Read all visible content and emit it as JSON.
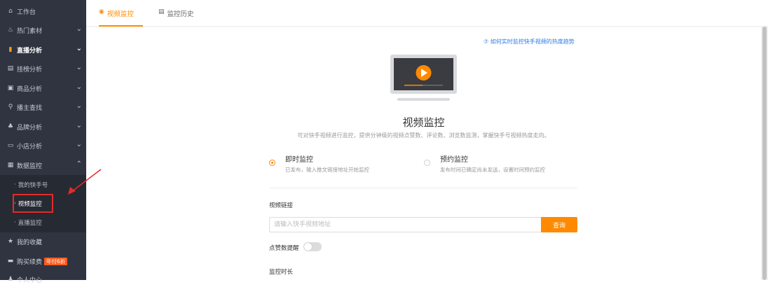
{
  "sidebar": {
    "items": [
      {
        "label": "工作台",
        "icon": "home-icon"
      },
      {
        "label": "热门素材",
        "icon": "flame-icon"
      },
      {
        "label": "直播分析",
        "icon": "bar-chart-icon"
      },
      {
        "label": "挂榜分析",
        "icon": "trend-icon"
      },
      {
        "label": "商品分析",
        "icon": "shop-icon"
      },
      {
        "label": "播主查找",
        "icon": "search-icon"
      },
      {
        "label": "品牌分析",
        "icon": "brand-icon"
      },
      {
        "label": "小店分析",
        "icon": "store-icon"
      },
      {
        "label": "数据监控",
        "icon": "monitor-icon"
      }
    ],
    "sub_items": [
      {
        "label": "我的快手号"
      },
      {
        "label": "视频监控"
      },
      {
        "label": "直播监控"
      }
    ],
    "bottom_items": [
      {
        "label": "我的收藏",
        "icon": "star-icon"
      },
      {
        "label": "购买续费",
        "icon": "card-icon",
        "badge": "年付6折"
      },
      {
        "label": "个人中心",
        "icon": "user-icon"
      }
    ]
  },
  "tabs": [
    {
      "label": "视频监控",
      "icon": "eye-icon",
      "active": true
    },
    {
      "label": "监控历史",
      "icon": "history-icon",
      "active": false
    }
  ],
  "main": {
    "help_link": "⑦ 如何实时监控快手视频的热度趋势",
    "title": "视频监控",
    "description": "可对快手视频进行监控，提供分钟级的视频点赞数、评论数、浏览数监测，掌握快手号视频热度走向。",
    "options": [
      {
        "title": "即时监控",
        "desc": "已发布，输入推文链接地址开始监控",
        "checked": true
      },
      {
        "title": "预约监控",
        "desc": "发布时间已确定尚未发送，设置时间预约监控",
        "checked": false
      }
    ],
    "video_link_label": "视频链接",
    "input_placeholder": "请输入快手视频地址",
    "input_value": "",
    "query_button": "查询",
    "like_reminder_label": "点赞数提醒",
    "like_reminder_on": false,
    "duration_label": "监控时长"
  },
  "colors": {
    "accent": "#ff8a00",
    "sidebar_bg": "#2f3440",
    "link": "#2a7ae2",
    "highlight": "#e32b2b"
  }
}
